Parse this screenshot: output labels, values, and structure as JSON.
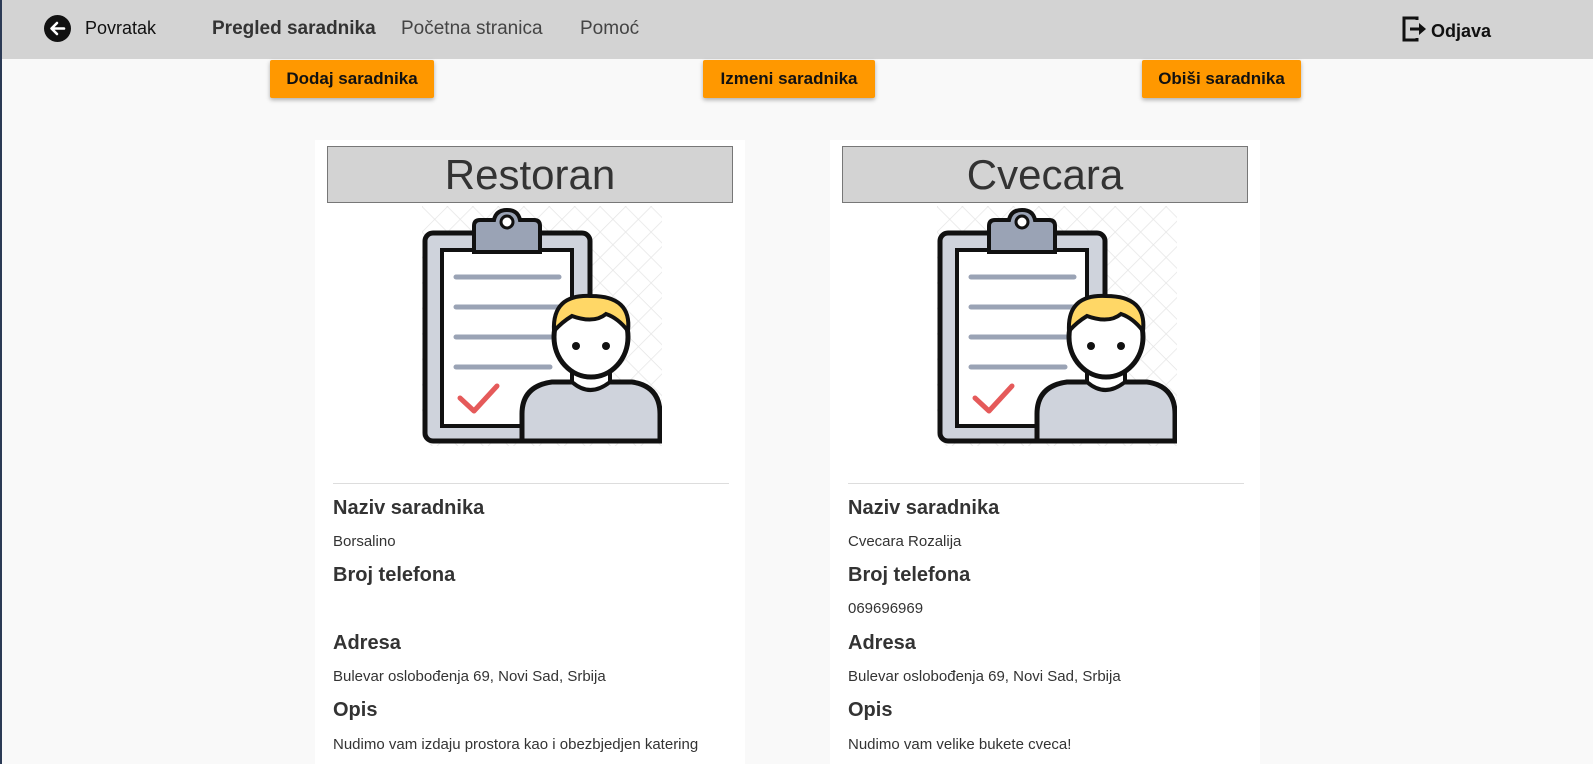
{
  "navbar": {
    "back_label": "Povratak",
    "links": [
      "Pregled saradnika",
      "Početna stranica",
      "Pomoć"
    ],
    "logout_label": "Odjava"
  },
  "actions": {
    "add_label": "Dodaj saradnika",
    "edit_label": "Izmeni saradnika",
    "delete_label": "Obiši saradnika"
  },
  "colors": {
    "navbar_bg": "#d3d3d3",
    "accent": "#ff9800",
    "page_bg": "#f9f9f9"
  },
  "cards": [
    {
      "title": "Restoran",
      "image_icon": "clipboard-person-icon",
      "name_label": "Naziv saradnika",
      "name_value": "Borsalino",
      "phone_label": "Broj telefona",
      "phone_value": "",
      "address_label": "Adresa",
      "address_value": "Bulevar oslobođenja 69, Novi Sad, Srbija",
      "desc_label": "Opis",
      "desc_value": "Nudimo vam izdaju prostora kao i obezbjedjen katering"
    },
    {
      "title": "Cvecara",
      "image_icon": "clipboard-person-icon",
      "name_label": "Naziv saradnika",
      "name_value": "Cvecara Rozalija",
      "phone_label": "Broj telefona",
      "phone_value": "069696969",
      "address_label": "Adresa",
      "address_value": "Bulevar oslobođenja 69, Novi Sad, Srbija",
      "desc_label": "Opis",
      "desc_value": "Nudimo vam velike bukete cveca!"
    }
  ]
}
